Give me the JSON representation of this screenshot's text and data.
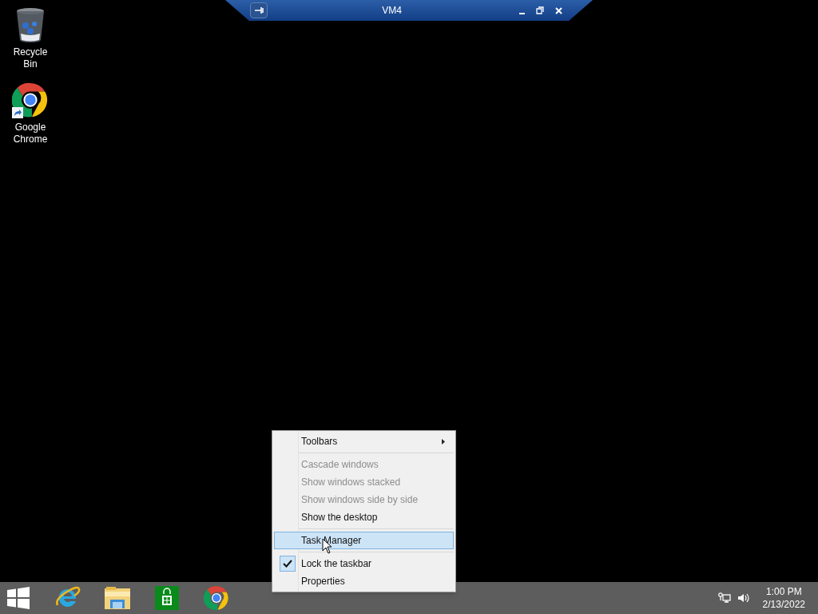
{
  "desktop_icons": [
    {
      "kind": "recycle-bin",
      "label": "Recycle Bin"
    },
    {
      "kind": "chrome",
      "label": "Google Chrome"
    }
  ],
  "connection_bar": {
    "title": "VM4"
  },
  "context_menu": [
    {
      "kind": "item",
      "label": "Toolbars",
      "disabled": false,
      "checked": false,
      "selected": false,
      "submenu": true
    },
    {
      "kind": "separator"
    },
    {
      "kind": "item",
      "label": "Cascade windows",
      "disabled": true,
      "checked": false,
      "selected": false,
      "submenu": false
    },
    {
      "kind": "item",
      "label": "Show windows stacked",
      "disabled": true,
      "checked": false,
      "selected": false,
      "submenu": false
    },
    {
      "kind": "item",
      "label": "Show windows side by side",
      "disabled": true,
      "checked": false,
      "selected": false,
      "submenu": false
    },
    {
      "kind": "item",
      "label": "Show the desktop",
      "disabled": false,
      "checked": false,
      "selected": false,
      "submenu": false
    },
    {
      "kind": "separator"
    },
    {
      "kind": "item",
      "label": "Task Manager",
      "disabled": false,
      "checked": false,
      "selected": true,
      "submenu": false
    },
    {
      "kind": "separator"
    },
    {
      "kind": "item",
      "label": "Lock the taskbar",
      "disabled": false,
      "checked": true,
      "selected": false,
      "submenu": false
    },
    {
      "kind": "item",
      "label": "Properties",
      "disabled": false,
      "checked": false,
      "selected": false,
      "submenu": false
    }
  ],
  "taskbar": {
    "apps": [
      {
        "kind": "start"
      },
      {
        "kind": "ie"
      },
      {
        "kind": "explorer"
      },
      {
        "kind": "store"
      },
      {
        "kind": "chrome"
      }
    ],
    "time": "1:00 PM",
    "date": "2/13/2022"
  }
}
